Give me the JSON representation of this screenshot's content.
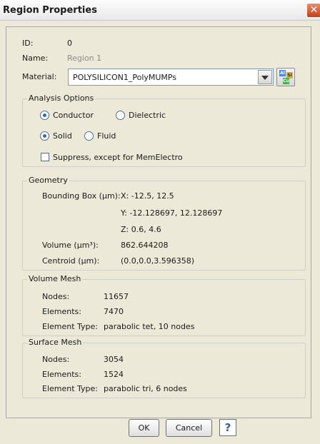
{
  "window": {
    "title": "Region Properties",
    "close_glyph": "✕"
  },
  "header": {
    "id_label": "ID:",
    "id_value": "0",
    "name_label": "Name:",
    "name_value": "Region 1",
    "material_label": "Material:",
    "material_value": "POLYSILICON1_PolyMUMPs",
    "material_icon_letters": [
      "Al",
      "Si",
      "Cu"
    ]
  },
  "analysis": {
    "title": "Analysis Options",
    "conductor_label": "Conductor",
    "dielectric_label": "Dielectric",
    "solid_label": "Solid",
    "fluid_label": "Fluid",
    "suppress_label": "Suppress, except for MemElectro",
    "conductor_selected": true,
    "solid_selected": true,
    "suppress_checked": false
  },
  "geometry": {
    "title": "Geometry",
    "bounding_label": "Bounding Box (µm):",
    "x_line": "X:  -12.5, 12.5",
    "y_line": "Y:  -12.128697, 12.128697",
    "z_line": "Z:  0.6, 4.6",
    "volume_label": "Volume (µm³):",
    "volume_value": "862.644208",
    "centroid_label": "Centroid (µm):",
    "centroid_value": "(0.0,0.0,3.596358)"
  },
  "volume_mesh": {
    "title": "Volume Mesh",
    "nodes_label": "Nodes:",
    "nodes_value": "11657",
    "elements_label": "Elements:",
    "elements_value": "7470",
    "type_label": "Element Type:",
    "type_value": "parabolic tet, 10 nodes"
  },
  "surface_mesh": {
    "title": "Surface Mesh",
    "nodes_label": "Nodes:",
    "nodes_value": "3054",
    "elements_label": "Elements:",
    "elements_value": "1524",
    "type_label": "Element Type:",
    "type_value": "parabolic tri, 6 nodes"
  },
  "footer": {
    "ok_label": "OK",
    "cancel_label": "Cancel",
    "help_glyph": "?"
  },
  "colors": {
    "background": "#ece9d8",
    "close_button": "#c5401d",
    "radio_dot": "#2b6dbf"
  },
  "icons": {
    "close": "close-icon",
    "dropdown": "chevron-down-icon",
    "material": "periodic-elements-icon",
    "help": "help-icon"
  }
}
